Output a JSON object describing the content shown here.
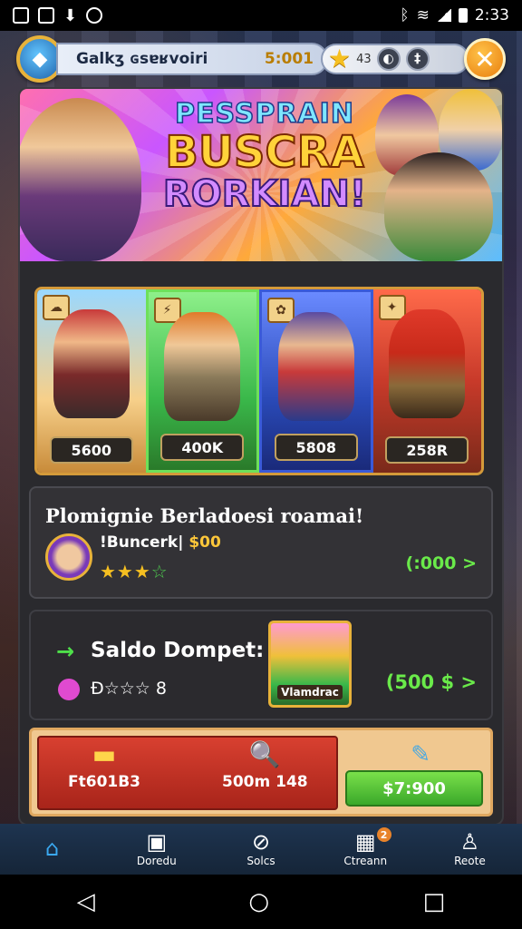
{
  "status_bar": {
    "time": "2:33",
    "left_icons": [
      "image-icon",
      "photo-icon",
      "download-icon",
      "app-icon"
    ],
    "right_icons": [
      "bluetooth-icon",
      "wifi-icon",
      "signal-icon",
      "battery-icon"
    ]
  },
  "header": {
    "username": "Galkʒ ɢsɐʁvoiri",
    "coins": "5:001",
    "stars_value": "43",
    "mini_btn_1": "◐",
    "mini_btn_2": "‡",
    "close_label": "✕"
  },
  "banner": {
    "line1": "PESSPRAIN",
    "line2": "BUSCRA",
    "line3": "RORKIAN!"
  },
  "cards": [
    {
      "value": "5600",
      "tag": "☁"
    },
    {
      "value": "400K",
      "tag": "⚡"
    },
    {
      "value": "5808",
      "tag": "✿"
    },
    {
      "value": "258R",
      "tag": "✦"
    }
  ],
  "quest": {
    "title": "Plomignie Berladoesi roamai!",
    "subtitle": "!Buncerk|",
    "subtitle_gold": "$00",
    "stars_filled": "★★★",
    "stars_empty": "☆",
    "reward": "(:000 >"
  },
  "wallet": {
    "arrow": "→",
    "title": "Saldo Dompet:",
    "rating": "Ð☆☆☆ 8",
    "thumb_label": "Vlamdrac",
    "amount": "(500 $ >"
  },
  "actions": {
    "item1_label": "Ft601B3",
    "item1_icon": "▬",
    "item2_label": "500m 148",
    "item2_icon": "🔍",
    "item3_icon": "✎",
    "green_button": "$7:900"
  },
  "nav": [
    {
      "label": "",
      "icon": "⌂",
      "active": true
    },
    {
      "label": "Doredu",
      "icon": "▣"
    },
    {
      "label": "Solcs",
      "icon": "⊘"
    },
    {
      "label": "Ctreann",
      "icon": "▦",
      "badge": "2"
    },
    {
      "label": "Reote",
      "icon": "♙"
    }
  ],
  "system_nav": {
    "back": "◁",
    "home": "○",
    "recent": "□"
  }
}
